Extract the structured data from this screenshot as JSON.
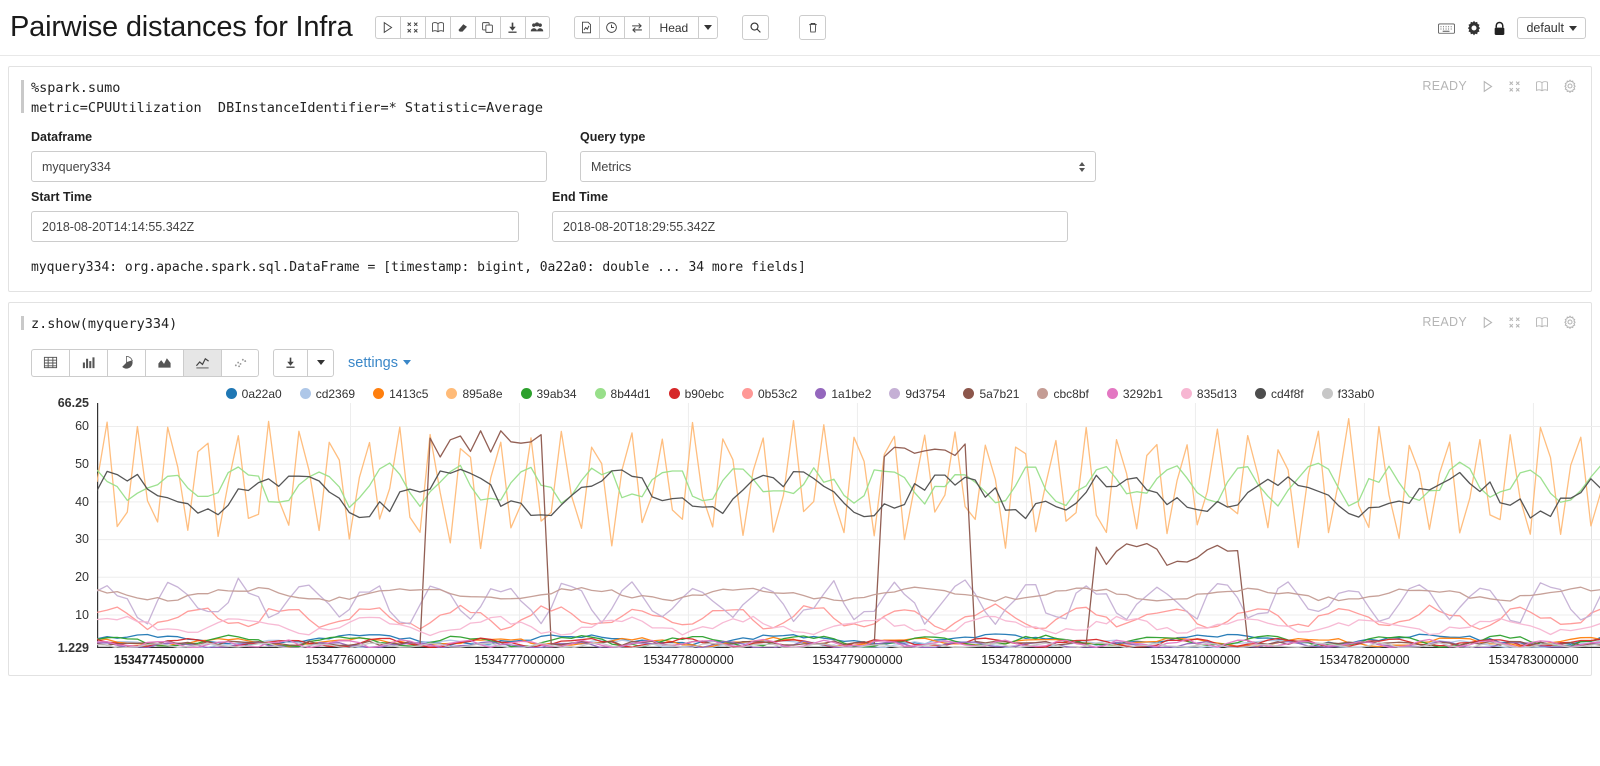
{
  "header": {
    "title": "Pairwise distances for Infra",
    "toolbar_primary": [
      {
        "name": "run-all-icon",
        "glyph": "play"
      },
      {
        "name": "collapse-all-icon",
        "glyph": "collapse"
      },
      {
        "name": "book-icon",
        "glyph": "book"
      },
      {
        "name": "eraser-icon",
        "glyph": "eraser"
      },
      {
        "name": "clone-icon",
        "glyph": "clone"
      },
      {
        "name": "export-icon",
        "glyph": "download"
      },
      {
        "name": "permissions-icon",
        "glyph": "people"
      }
    ],
    "toolbar_secondary": [
      {
        "name": "report-icon",
        "glyph": "report"
      },
      {
        "name": "clock-icon",
        "glyph": "clock"
      },
      {
        "name": "swap-icon",
        "glyph": "swap"
      }
    ],
    "head_label": "Head",
    "search_icon": "search-icon",
    "trash_icon": "trash-icon",
    "keyboard_icon": "keyboard-icon",
    "gear_icon": "gear-icon",
    "lock_icon": "lock-icon",
    "interpreter_label": "default"
  },
  "paragraph1": {
    "code_lines": [
      "%spark.sumo",
      "metric=CPUUtilization  DBInstanceIdentifier=* Statistic=Average"
    ],
    "status": "READY",
    "status_icons": [
      {
        "name": "run-paragraph-icon"
      },
      {
        "name": "collapse-paragraph-icon"
      },
      {
        "name": "book-paragraph-icon"
      },
      {
        "name": "settings-paragraph-icon"
      }
    ],
    "fields": [
      {
        "label": "Dataframe",
        "value": "myquery334",
        "type": "text",
        "name": "dataframe-field"
      },
      {
        "label": "Query type",
        "value": "Metrics",
        "type": "select",
        "name": "query-type-select"
      },
      {
        "label": "Start Time",
        "value": "2018-08-20T14:14:55.342Z",
        "type": "text",
        "name": "start-time-field"
      },
      {
        "label": "End Time",
        "value": "2018-08-20T18:29:55.342Z",
        "type": "text",
        "name": "end-time-field"
      }
    ],
    "output": "myquery334: org.apache.spark.sql.DataFrame = [timestamp: bigint, 0a22a0: double ... 34 more fields]"
  },
  "paragraph2": {
    "code_lines": [
      "z.show(myquery334)"
    ],
    "status": "READY",
    "viz_buttons": [
      {
        "name": "viz-table-button",
        "glyph": "table",
        "active": false
      },
      {
        "name": "viz-bar-button",
        "glyph": "bar",
        "active": false
      },
      {
        "name": "viz-pie-button",
        "glyph": "pie",
        "active": false
      },
      {
        "name": "viz-area-button",
        "glyph": "area",
        "active": false
      },
      {
        "name": "viz-line-button",
        "glyph": "line",
        "active": true
      },
      {
        "name": "viz-scatter-button",
        "glyph": "scatter",
        "active": false
      }
    ],
    "download_label": "download-icon",
    "settings_label": "settings"
  },
  "chart_data": {
    "type": "line",
    "title": "",
    "xlabel": "",
    "ylabel": "",
    "grid": true,
    "legend_position": "top",
    "ylim": [
      1.229,
      66.25
    ],
    "yticks": [
      66.25,
      60,
      50,
      40,
      30,
      20,
      10,
      1.229
    ],
    "ytick_labels": [
      "66.25",
      "60",
      "50",
      "40",
      "30",
      "20",
      "10",
      "1.229"
    ],
    "xlim": [
      1534774500000,
      1534783400000
    ],
    "xticks": [
      1534774500000,
      1534776000000,
      1534777000000,
      1534778000000,
      1534779000000,
      1534780000000,
      1534781000000,
      1534782000000,
      1534783000000
    ],
    "xtick_labels": [
      "1534774500000",
      "1534776000000",
      "1534777000000",
      "1534778000000",
      "1534779000000",
      "1534780000000",
      "1534781000000",
      "1534782000000",
      "1534783000000"
    ],
    "series": [
      {
        "name": "0a22a0",
        "color": "#1f77b4",
        "baseline": 3.4,
        "amp": 1.1,
        "freq": 7,
        "phase": 0.2,
        "noise": 0.5
      },
      {
        "name": "cd2369",
        "color": "#aec7e8",
        "baseline": 2.2,
        "amp": 0.8,
        "freq": 9,
        "phase": 1.1,
        "noise": 0.4
      },
      {
        "name": "1413c5",
        "color": "#ff7f0e",
        "baseline": 2.8,
        "amp": 0.9,
        "freq": 11,
        "phase": 2.0,
        "noise": 0.4
      },
      {
        "name": "895a8e",
        "color": "#ffbb78",
        "baseline": 45.0,
        "amp": 15.0,
        "freq": 46,
        "phase": 0.0,
        "noise": 3.0
      },
      {
        "name": "39ab34",
        "color": "#2ca02c",
        "baseline": 3.0,
        "amp": 1.2,
        "freq": 13,
        "phase": 0.6,
        "noise": 0.5
      },
      {
        "name": "8b44d1",
        "color": "#98df8a",
        "baseline": 44.5,
        "amp": 4.0,
        "freq": 21,
        "phase": 1.4,
        "noise": 2.2
      },
      {
        "name": "b90ebc",
        "color": "#d62728",
        "baseline": 2.6,
        "amp": 0.9,
        "freq": 15,
        "phase": 2.4,
        "noise": 0.4
      },
      {
        "name": "0b53c2",
        "color": "#ff9896",
        "baseline": 9.5,
        "amp": 2.6,
        "freq": 17,
        "phase": 0.9,
        "noise": 1.1
      },
      {
        "name": "1a1be2",
        "color": "#9467bd",
        "baseline": 2.0,
        "amp": 0.7,
        "freq": 19,
        "phase": 1.8,
        "noise": 0.35
      },
      {
        "name": "9d3754",
        "color": "#c5b0d5",
        "baseline": 13.5,
        "amp": 4.5,
        "freq": 23,
        "phase": 0.3,
        "noise": 2.0
      },
      {
        "name": "5a7b21",
        "color": "#8c564b",
        "baseline": 5.0,
        "amp": 1.0,
        "freq": 5,
        "phase": 0.0,
        "noise": 0.6
      },
      {
        "name": "cbc8bf",
        "color": "#c49c94",
        "baseline": 15.5,
        "amp": 1.3,
        "freq": 9,
        "phase": 2.2,
        "noise": 0.6
      },
      {
        "name": "3292b1",
        "color": "#e377c2",
        "baseline": 2.4,
        "amp": 0.8,
        "freq": 25,
        "phase": 1.0,
        "noise": 0.4
      },
      {
        "name": "835d13",
        "color": "#f7b6d2",
        "baseline": 7.2,
        "amp": 1.8,
        "freq": 12,
        "phase": 0.5,
        "noise": 0.9
      },
      {
        "name": "cd4f8f",
        "color": "#4d4d4d",
        "baseline": 42.0,
        "amp": 4.5,
        "freq": 9,
        "phase": 0.8,
        "noise": 2.5
      },
      {
        "name": "f33ab0",
        "color": "#c7c7c7",
        "baseline": 1.8,
        "amp": 0.6,
        "freq": 27,
        "phase": 1.5,
        "noise": 0.3
      }
    ]
  }
}
